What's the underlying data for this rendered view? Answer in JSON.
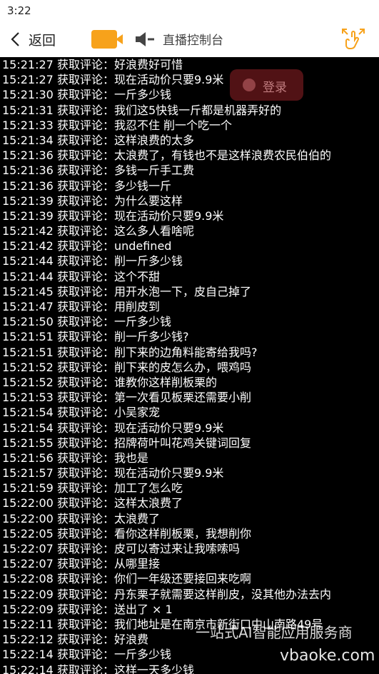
{
  "status_bar": {
    "time": "3:22"
  },
  "toolbar": {
    "back_label": "返回",
    "title": "直播控制台"
  },
  "background_overlay": {
    "login_label": "登录"
  },
  "log_prefix": "获取评论：",
  "log": [
    {
      "time": "15:21:27",
      "text": "好浪费好可惜"
    },
    {
      "time": "15:21:27",
      "text": "现在活动价只要9.9米"
    },
    {
      "time": "15:21:30",
      "text": "一斤多少钱"
    },
    {
      "time": "15:21:31",
      "text": "我们这5快钱一斤都是机器弄好的"
    },
    {
      "time": "15:21:33",
      "text": "我忍不住 削一个吃一个"
    },
    {
      "time": "15:21:34",
      "text": "这样浪费的太多"
    },
    {
      "time": "15:21:36",
      "text": "太浪费了，有钱也不是这样浪费农民伯伯的"
    },
    {
      "time": "15:21:36",
      "text": "多钱一斤手工费"
    },
    {
      "time": "15:21:36",
      "text": "多少钱一斤"
    },
    {
      "time": "15:21:39",
      "text": "为什么要这样"
    },
    {
      "time": "15:21:39",
      "text": "现在活动价只要9.9米"
    },
    {
      "time": "15:21:42",
      "text": "这么多人看啥呢"
    },
    {
      "time": "15:21:42",
      "text": "undefined"
    },
    {
      "time": "15:21:44",
      "text": "削一斤多少钱"
    },
    {
      "time": "15:21:44",
      "text": "这个不甜"
    },
    {
      "time": "15:21:45",
      "text": "用开水泡一下，皮自己掉了"
    },
    {
      "time": "15:21:47",
      "text": "用削皮到"
    },
    {
      "time": "15:21:50",
      "text": "一斤多少钱"
    },
    {
      "time": "15:21:51",
      "text": "削一斤多少钱?"
    },
    {
      "time": "15:21:51",
      "text": "削下来的边角料能寄给我吗?"
    },
    {
      "time": "15:21:52",
      "text": "削下来的皮怎么办，喂鸡吗"
    },
    {
      "time": "15:21:52",
      "text": "谁教你这样削板栗的"
    },
    {
      "time": "15:21:53",
      "text": "第一次看见板栗还需要小削"
    },
    {
      "time": "15:21:54",
      "text": "小吴家宠"
    },
    {
      "time": "15:21:54",
      "text": "现在活动价只要9.9米"
    },
    {
      "time": "15:21:55",
      "text": "招牌荷叶叫花鸡关键词回复"
    },
    {
      "time": "15:21:56",
      "text": "我也是"
    },
    {
      "time": "15:21:57",
      "text": "现在活动价只要9.9米"
    },
    {
      "time": "15:21:59",
      "text": "加工了怎么吃"
    },
    {
      "time": "15:22:00",
      "text": "这样太浪费了"
    },
    {
      "time": "15:22:00",
      "text": "太浪费了"
    },
    {
      "time": "15:22:05",
      "text": "看你这样削板栗，我想削你"
    },
    {
      "time": "15:22:07",
      "text": "皮可以寄过来让我嗦嗦吗"
    },
    {
      "time": "15:22:07",
      "text": "从哪里接"
    },
    {
      "time": "15:22:08",
      "text": "你们一年级还要接回来吃啊"
    },
    {
      "time": "15:22:09",
      "text": "丹东栗子就需要这样削皮，没其他办法去内"
    },
    {
      "time": "15:22:09",
      "text": "送出了 × 1"
    },
    {
      "time": "15:22:11",
      "text": "我们地址是在南京市新街口中山南路49号"
    },
    {
      "time": "15:22:12",
      "text": "好浪费"
    },
    {
      "time": "15:22:14",
      "text": "一斤多少钱"
    },
    {
      "time": "15:22:14",
      "text": "这样一天多少钱"
    }
  ],
  "watermark": {
    "line1": "一站式AI智能应用服务商",
    "line2": "vbaoke.com"
  },
  "colors": {
    "accent": "#f7a21b",
    "log_bg": "#000000",
    "log_text": "#ffffff"
  }
}
